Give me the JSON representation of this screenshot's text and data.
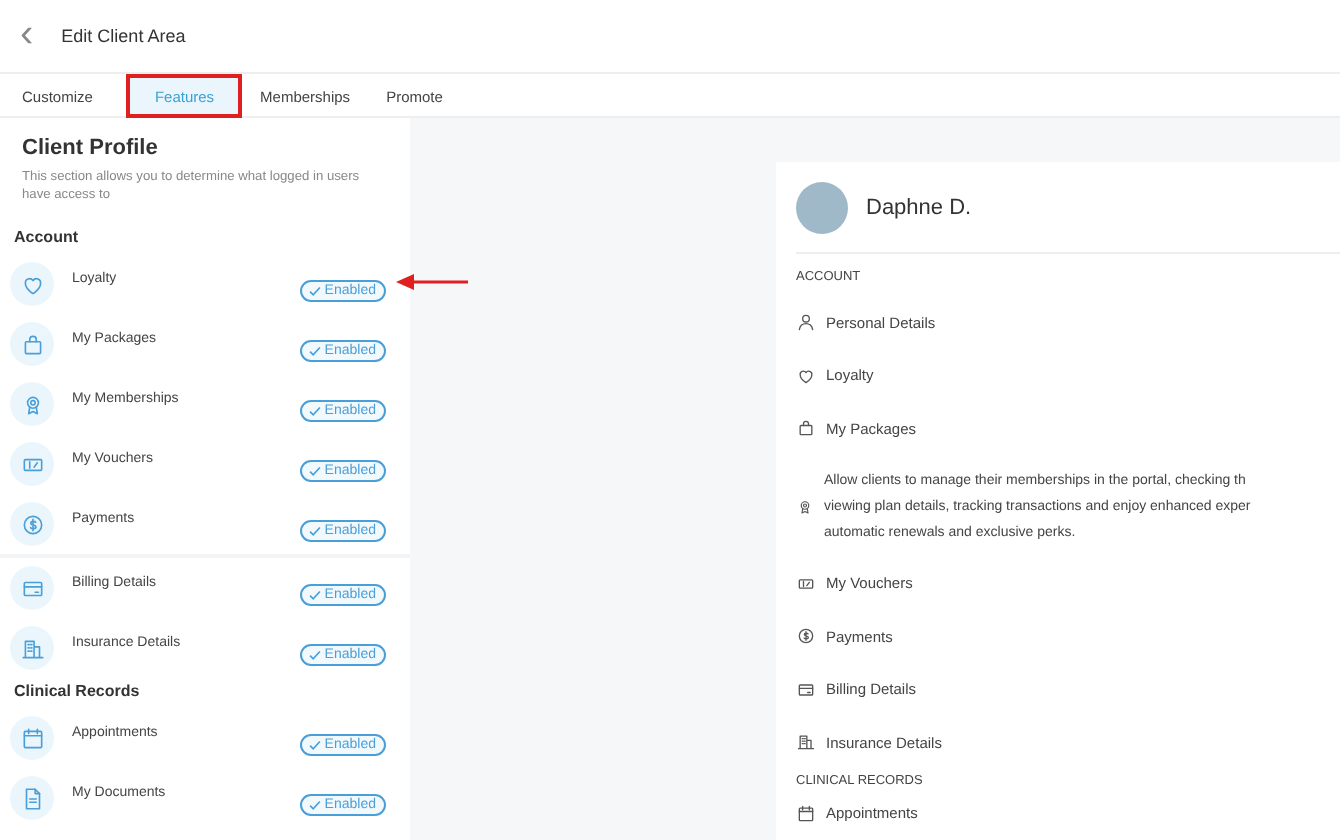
{
  "header": {
    "back": "‹",
    "title": "Edit Client Area"
  },
  "tabs": [
    {
      "label": "Customize",
      "selected": false,
      "highlighted": false
    },
    {
      "label": "Features",
      "selected": true,
      "highlighted": true
    },
    {
      "label": "Memberships",
      "selected": false,
      "highlighted": false
    },
    {
      "label": "Promote",
      "selected": false,
      "highlighted": false
    }
  ],
  "panel": {
    "title": "Client Profile",
    "description": "This section allows you to determine what logged in users have access to",
    "sections": [
      {
        "title": "Account",
        "groups": [
          [
            {
              "label": "Loyalty",
              "status": "Enabled",
              "enabled": true,
              "pointed": true
            },
            {
              "label": "My Packages",
              "status": "Enabled",
              "enabled": true
            },
            {
              "label": "My Memberships",
              "status": "Enabled",
              "enabled": true
            },
            {
              "label": "My Vouchers",
              "status": "Enabled",
              "enabled": true
            },
            {
              "label": "Payments",
              "status": "Enabled",
              "enabled": true
            }
          ],
          [
            {
              "label": "Billing Details",
              "status": "Enabled",
              "enabled": true
            },
            {
              "label": "Insurance Details",
              "status": "Enabled",
              "enabled": true
            }
          ]
        ]
      },
      {
        "title": "Clinical Records",
        "groups": [
          [
            {
              "label": "Appointments",
              "status": "Enabled",
              "enabled": true
            },
            {
              "label": "My Documents",
              "status": "Enabled",
              "enabled": true
            }
          ]
        ]
      }
    ]
  },
  "preview": {
    "name": "Daphne D.",
    "sections": [
      {
        "title": "ACCOUNT",
        "items": [
          {
            "label": "Personal Details"
          },
          {
            "label": "Loyalty"
          },
          {
            "label": "My Packages"
          },
          {
            "lines": [
              "Allow clients to manage their memberships in the portal, checking th",
              "viewing plan details, tracking transactions and enjoy enhanced exper",
              "automatic renewals and exclusive perks."
            ]
          },
          {
            "label": "My Vouchers"
          },
          {
            "label": "Payments"
          },
          {
            "label": "Billing Details"
          },
          {
            "label": "Insurance Details"
          }
        ]
      },
      {
        "title": "CLINICAL RECORDS",
        "items": [
          {
            "label": "Appointments"
          }
        ]
      }
    ]
  }
}
